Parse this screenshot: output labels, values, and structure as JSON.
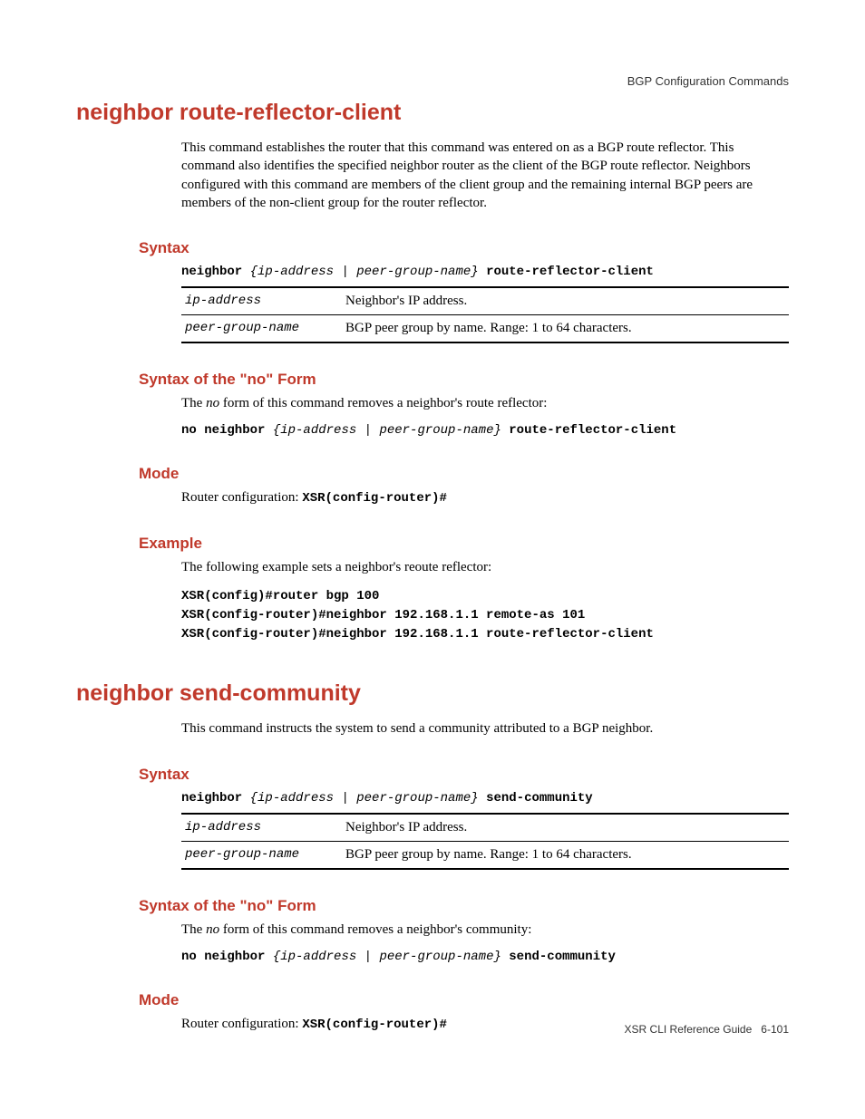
{
  "header": "BGP Configuration Commands",
  "footer_left": "XSR CLI Reference Guide",
  "footer_right": "6-101",
  "s1": {
    "title": "neighbor route-reflector-client",
    "intro": "This command establishes the router that this command was entered on as a BGP route reflector. This command also identifies the specified neighbor router as the client of the BGP route reflector. Neighbors configured with this command are members of the client group and the remaining internal BGP peers are members of the non-client group for the router reflector.",
    "syntax_h": "Syntax",
    "syntax_kw1": "neighbor",
    "syntax_args": "{ip-address | peer-group-name}",
    "syntax_kw2": "route-reflector-client",
    "tbl": {
      "r1c1": "ip-address",
      "r1c2": "Neighbor's IP address.",
      "r2c1": "peer-group-name",
      "r2c2": "BGP peer group by name. Range: 1 to 64 characters."
    },
    "noform_h": "Syntax of the \"no\" Form",
    "noform_pre": "The ",
    "noform_em": "no",
    "noform_post": " form of this command removes a neighbor's route reflector:",
    "no_kw1": "no neighbor",
    "no_args": "{ip-address | peer-group-name}",
    "no_kw2": "route-reflector-client",
    "mode_h": "Mode",
    "mode_pre": "Router configuration: ",
    "mode_code": "XSR(config-router)#",
    "ex_h": "Example",
    "ex_intro": "The following example sets a neighbor's reoute reflector:",
    "ex_code": "XSR(config)#router bgp 100\nXSR(config-router)#neighbor 192.168.1.1 remote-as 101\nXSR(config-router)#neighbor 192.168.1.1 route-reflector-client"
  },
  "s2": {
    "title": "neighbor send-community",
    "intro": "This command instructs the system to send a community attributed to a BGP neighbor.",
    "syntax_h": "Syntax",
    "syntax_kw1": "neighbor",
    "syntax_args": "{ip-address | peer-group-name}",
    "syntax_kw2": "send-community",
    "tbl": {
      "r1c1": "ip-address",
      "r1c2": "Neighbor's IP address.",
      "r2c1": "peer-group-name",
      "r2c2": "BGP peer group by name. Range: 1 to 64 characters."
    },
    "noform_h": "Syntax of the \"no\" Form",
    "noform_pre": "The ",
    "noform_em": "no",
    "noform_post": " form of this command removes a neighbor's community:",
    "no_kw1": "no neighbor",
    "no_args": "{ip-address | peer-group-name}",
    "no_kw2": "send-community",
    "mode_h": "Mode",
    "mode_pre": "Router configuration: ",
    "mode_code": "XSR(config-router)#"
  }
}
